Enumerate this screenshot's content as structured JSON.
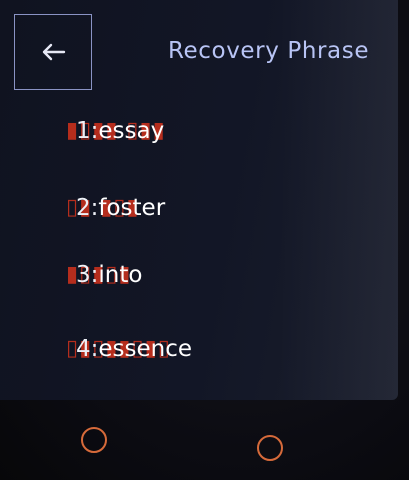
{
  "header": {
    "title": "Recovery Phrase",
    "back_icon": "arrow-left-icon"
  },
  "words": [
    {
      "index": "1:",
      "word": "essay"
    },
    {
      "index": "2:",
      "word": "foster"
    },
    {
      "index": "3:",
      "word": "into"
    },
    {
      "index": "4:",
      "word": "essence"
    }
  ],
  "colors": {
    "title": "#b8c4f5",
    "border": "#8a93c4",
    "word": "#ffffff",
    "hardware_button": "#d66a3a"
  }
}
